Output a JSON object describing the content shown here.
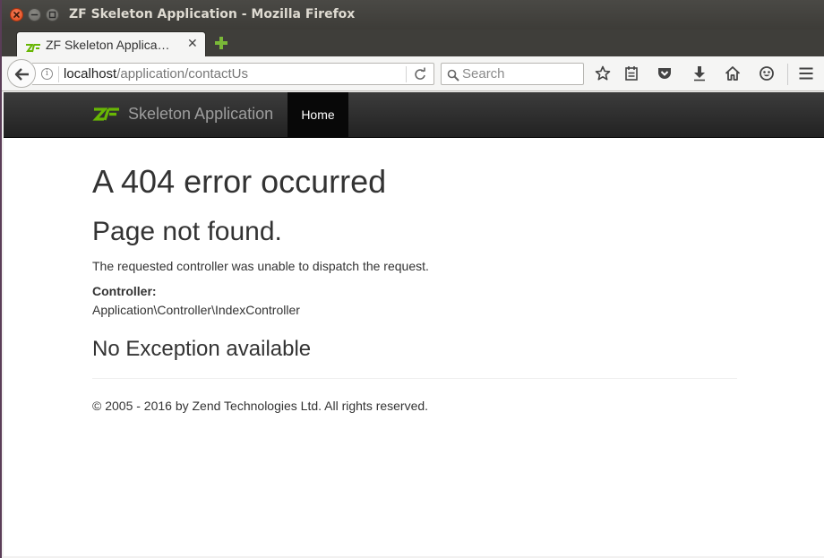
{
  "window": {
    "title": "ZF Skeleton Application - Mozilla Firefox"
  },
  "tab": {
    "title": "ZF Skeleton Applica…",
    "close_glyph": "✕"
  },
  "urlbar": {
    "host": "localhost",
    "path": "/application/contactUs",
    "info_glyph": "i"
  },
  "search": {
    "placeholder": "Search"
  },
  "toolbar": {
    "icons": [
      "star-icon",
      "reading-list-icon",
      "pocket-icon",
      "download-icon",
      "home-icon",
      "smiley-icon",
      "hamburger-menu-icon"
    ]
  },
  "site": {
    "brand_name": "Skeleton Application",
    "nav_home": "Home"
  },
  "page": {
    "heading": "A 404 error occurred",
    "subheading": "Page not found.",
    "message": "The requested controller was unable to dispatch the request.",
    "controller_label": "Controller:",
    "controller_value": "Application\\Controller\\IndexController",
    "exception_heading": "No Exception available",
    "footer": "© 2005 - 2016 by Zend Technologies Ltd. All rights reserved."
  },
  "colors": {
    "zf_green": "#68b604",
    "navbar_dark": "#222222",
    "firefox_titlebar": "#3c3b37",
    "close_orange": "#e95420"
  }
}
